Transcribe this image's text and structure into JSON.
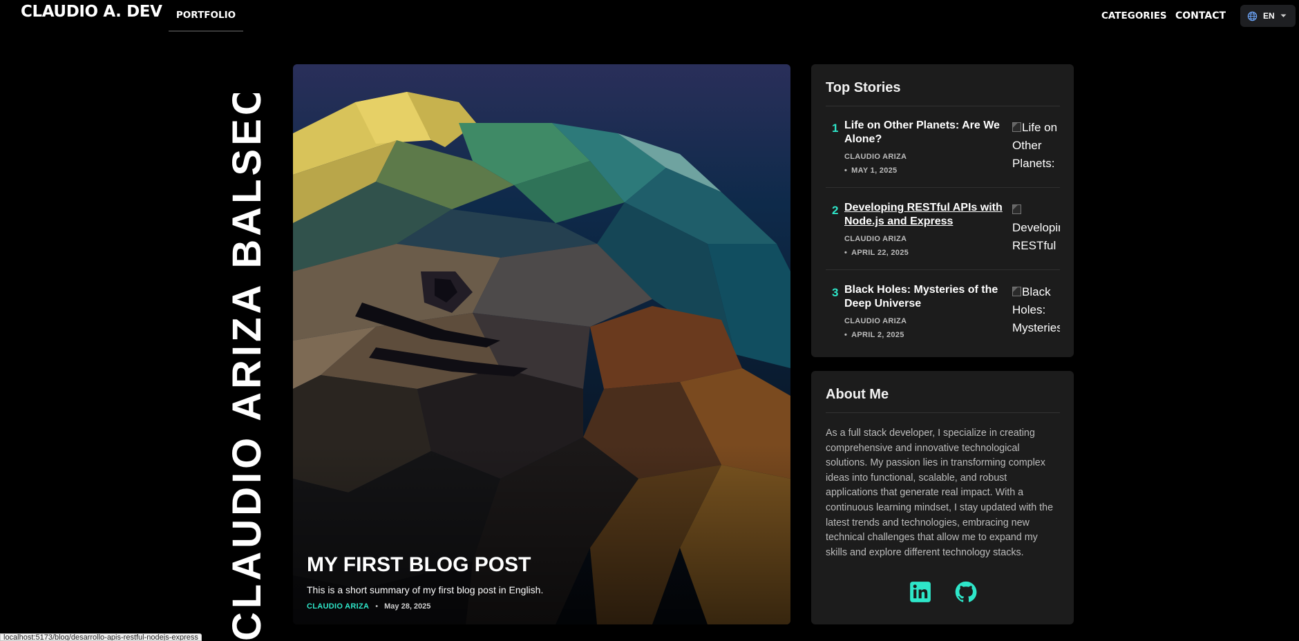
{
  "nav": {
    "brand": "CLAUDIO A. DEV",
    "portfolio": "PORTFOLIO",
    "categories": "CATEGORIES",
    "contact": "CONTACT",
    "language": "EN"
  },
  "vertical_name": "CLAUDIO ARIZA BALSECA",
  "hero": {
    "title": "MY FIRST BLOG POST",
    "summary": "This is a short summary of my first blog post in English.",
    "author": "CLAUDIO ARIZA",
    "separator": "•",
    "date": "May 28, 2025"
  },
  "top_stories": {
    "heading": "Top Stories",
    "items": [
      {
        "rank": "1",
        "title": "Life on Other Planets: Are We Alone?",
        "author": "CLAUDIO ARIZA",
        "dot": "•",
        "date": "MAY 1, 2025",
        "image_alt": "Life on Other Planets:",
        "hovered": false
      },
      {
        "rank": "2",
        "title": "Developing RESTful APIs with Node.js and Express",
        "author": "CLAUDIO ARIZA",
        "dot": "•",
        "date": "APRIL 22, 2025",
        "image_alt": "Developin RESTful",
        "hovered": true
      },
      {
        "rank": "3",
        "title": "Black Holes: Mysteries of the Deep Universe",
        "author": "CLAUDIO ARIZA",
        "dot": "•",
        "date": "APRIL 2, 2025",
        "image_alt": "Black Holes: Mysteries",
        "hovered": false
      }
    ]
  },
  "about": {
    "heading": "About Me",
    "text": "As a full stack developer, I specialize in creating comprehensive and innovative technological solutions. My passion lies in transforming complex ideas into functional, scalable, and robust applications that generate real impact. With a continuous learning mindset, I stay updated with the latest trends and technologies, embracing new technical challenges that allow me to expand my skills and explore different technology stacks.",
    "social": [
      "linkedin-icon",
      "github-icon"
    ]
  },
  "status_bar": "localhost:5173/blog/desarrollo-apis-restful-nodejs-express",
  "colors": {
    "accent": "#2ee6c9",
    "background": "#000000",
    "card": "#1c1c1c"
  }
}
